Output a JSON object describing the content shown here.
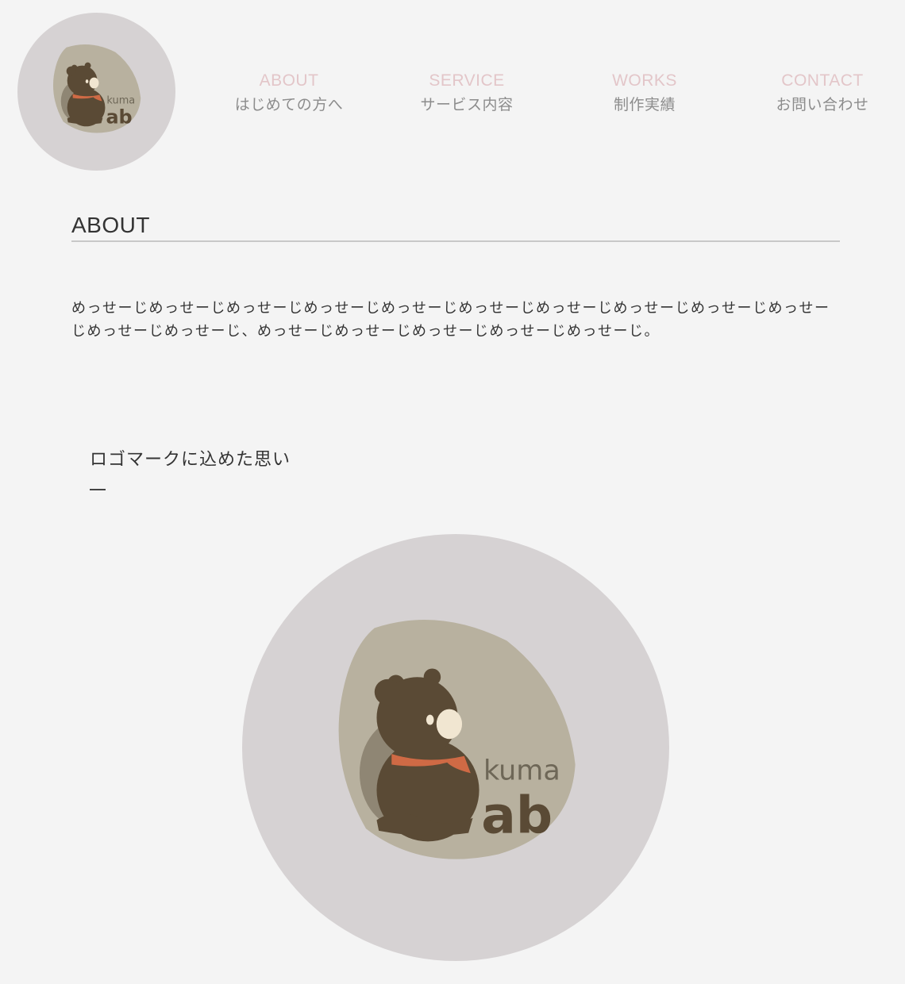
{
  "header": {
    "logo": {
      "icon": "kuma-lab-bear-logo",
      "text_top": "kuma",
      "text_bottom": "ab"
    }
  },
  "nav": [
    {
      "en": "ABOUT",
      "ja": "はじめての方へ"
    },
    {
      "en": "SERVICE",
      "ja": "サービス内容"
    },
    {
      "en": "WORKS",
      "ja": "制作実績"
    },
    {
      "en": "CONTACT",
      "ja": "お問い合わせ"
    }
  ],
  "about": {
    "title": "ABOUT",
    "message": "めっせーじめっせーじめっせーじめっせーじめっせーじめっせーじめっせーじめっせーじめっせーじめっせーじめっせーじめっせーじ、めっせーじめっせーじめっせーじめっせーじめっせーじ。"
  },
  "logo_section": {
    "title": "ロゴマークに込めた思い",
    "logo": {
      "icon": "kuma-lab-bear-logo",
      "text_top": "kuma",
      "text_bottom": "ab"
    }
  },
  "colors": {
    "background": "#f4f4f4",
    "logo_circle": "#d6d2d3",
    "logo_blob": "#b8b19f",
    "bear": "#5a4a35",
    "scarf": "#cf6a45",
    "nav_en": "#e3c6c9",
    "nav_ja": "#8c8c8c",
    "text": "#333333",
    "divider": "#c8c8c8"
  }
}
